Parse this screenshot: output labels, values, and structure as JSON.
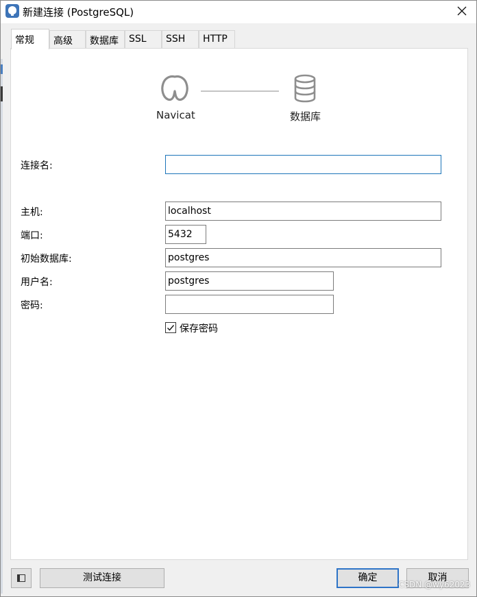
{
  "window": {
    "title": "新建连接 (PostgreSQL)"
  },
  "tabs": [
    {
      "label": "常规",
      "active": true
    },
    {
      "label": "高级"
    },
    {
      "label": "数据库"
    },
    {
      "label": "SSL"
    },
    {
      "label": "SSH"
    },
    {
      "label": "HTTP"
    }
  ],
  "header": {
    "left_caption": "Navicat",
    "right_caption": "数据库"
  },
  "form": {
    "connection_name": {
      "label": "连接名:",
      "value": ""
    },
    "host": {
      "label": "主机:",
      "value": "localhost"
    },
    "port": {
      "label": "端口:",
      "value": "5432"
    },
    "initial_db": {
      "label": "初始数据库:",
      "value": "postgres"
    },
    "username": {
      "label": "用户名:",
      "value": "postgres"
    },
    "password": {
      "label": "密码:",
      "value": ""
    },
    "save_password": {
      "label": "保存密码",
      "checked": true
    }
  },
  "footer": {
    "test_label": "测试连接",
    "ok_label": "确定",
    "cancel_label": "取消"
  },
  "watermark": "CSDN @wy62023",
  "colors": {
    "accent": "#1a73b8",
    "default_button_border": "#2c73c7",
    "icon_gray": "#8e8e8e"
  }
}
